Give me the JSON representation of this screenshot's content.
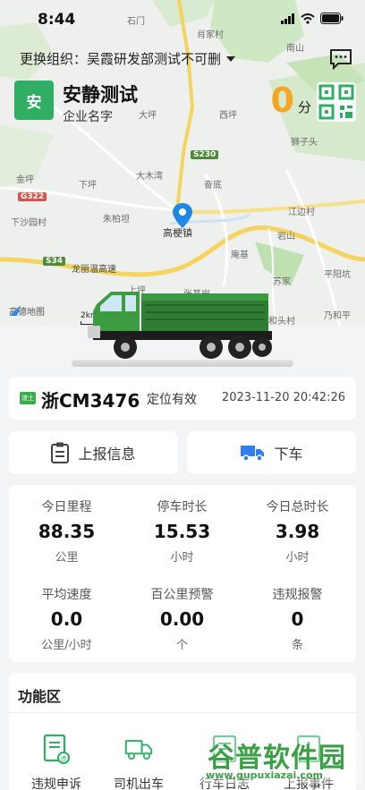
{
  "status_bar": {
    "time": "8:44"
  },
  "map": {
    "labels": [
      "石门",
      "肖家村",
      "大坪",
      "西坪",
      "南山",
      "狮子头",
      "金坪",
      "下坪",
      "大木湾",
      "奋底",
      "朱柏坦",
      "下沙园村",
      "高梗镇",
      "江边村",
      "岩山",
      "庵基",
      "苏家",
      "平阳坑",
      "龙丽温高速",
      "张基岩",
      "上坪",
      "乃和平",
      "和头村"
    ],
    "roads": [
      "S230",
      "G322",
      "S34"
    ],
    "attribution": "高德地图",
    "scale": "2km"
  },
  "org": {
    "prefix": "更换组织：",
    "name": "吴霞研发部测试不可删"
  },
  "company": {
    "logo_char": "安",
    "name": "安静测试",
    "subtitle": "企业名字"
  },
  "score": {
    "value": "0",
    "unit": "分"
  },
  "vehicle": {
    "badge": "渣土",
    "plate": "浙CM3476",
    "location_status": "定位有效",
    "timestamp": "2023-11-20 20:42:26"
  },
  "actions": {
    "report": "上报信息",
    "alight": "下车"
  },
  "stats": [
    {
      "label": "今日里程",
      "value": "88.35",
      "unit": "公里"
    },
    {
      "label": "停车时长",
      "value": "15.53",
      "unit": "小时"
    },
    {
      "label": "今日总时长",
      "value": "3.98",
      "unit": "小时"
    },
    {
      "label": "平均速度",
      "value": "0.0",
      "unit": "公里/小时"
    },
    {
      "label": "百公里预警",
      "value": "0.00",
      "unit": "个"
    },
    {
      "label": "违规报警",
      "value": "0",
      "unit": "条"
    }
  ],
  "functions": {
    "title": "功能区",
    "items": [
      {
        "label": "违规申诉",
        "icon": "appeal-document-icon"
      },
      {
        "label": "司机出车",
        "icon": "truck-icon"
      },
      {
        "label": "行车日志",
        "icon": "log-icon"
      },
      {
        "label": "上报事件",
        "icon": "report-event-icon"
      }
    ]
  },
  "watermark": {
    "text": "谷普软件园",
    "url": "www.gupuxiazai.com"
  },
  "colors": {
    "brand_green": "#2fae64",
    "score_orange": "#f5a623",
    "truck_green": "#2e7d32"
  }
}
